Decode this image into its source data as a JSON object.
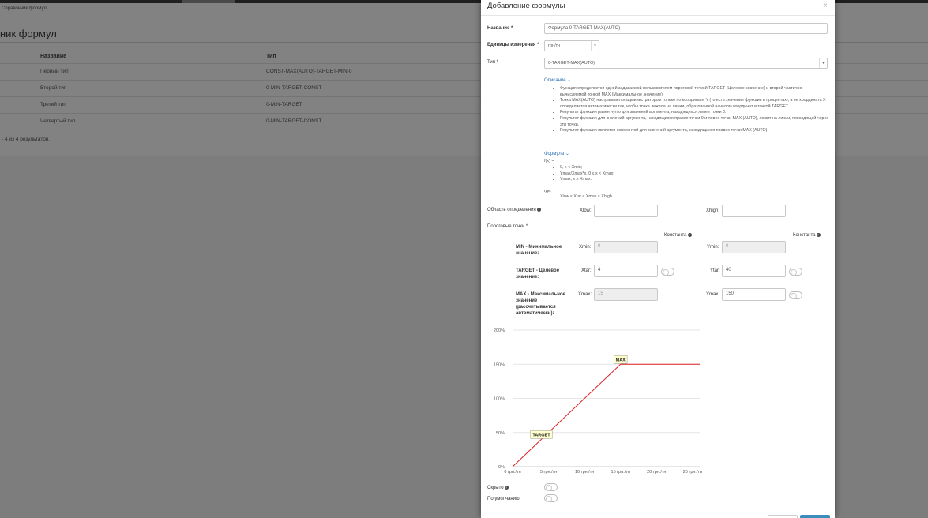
{
  "background": {
    "breadcrumb": "Справочник формул",
    "title": "ник формул",
    "columns": [
      "Название",
      "Тип"
    ],
    "rows": [
      {
        "name": "Первый тип",
        "type": "CONST-MAX(AUTO)-TARGET-MIN-0"
      },
      {
        "name": "Второй тип",
        "type": "0-MIN-TARGET-CONST"
      },
      {
        "name": "Третий тип",
        "type": "0-MIN-TARGET"
      },
      {
        "name": "Четвертый тип",
        "type": "0-MIN-TARGET-CONST"
      }
    ],
    "summary": "- 4 из 4 результатов."
  },
  "modal": {
    "title": "Добавление формулы",
    "close": "×",
    "name_label": "Название *",
    "name_value": "Формула 0-TARGET-MAX(AUTO)",
    "units_label": "Единицы измерения *",
    "units_value": "грн/тн",
    "type_label": "Тип *",
    "type_value": "0-TARGET-MAX(AUTO)",
    "description_link": "Описание",
    "description_items": [
      "Функция определяется одной задаваемой пользователем пороговой точкой TARGET (Целевое значение) и второй частично вычисляемой точкой MAX (Максимальное значение).",
      "Точка MAX(AUTO) настраивается администратором только по координате Y (то есть значение функции в процентах), а ее координата X определяется автоматически так, чтобы точка лежала на линии, образованной началом координат и точкой TARGET.",
      "Результат функции равен нулю для значений аргумента, находящихся левее точки 0.",
      "Результат функции для значений аргумента, находящихся правее точки 0 и левее точки MAX (AUTO), лежит на линии, проходящей через эти точки.",
      "Результат функции является константой для значений аргумента, находящихся правее точки MAX (AUTO)."
    ],
    "formula_link": "Формула",
    "formula_fx": "f(x) =",
    "formula_items": [
      "0, x < Xmin;",
      "Ymax/Xmax*x, 0 ≤ x < Xmax;",
      "Ymax, x ≥ Xmax."
    ],
    "formula_where": "где:",
    "formula_cond": "Xlow ≤ Xtar ≤ Xmax ≤ Xhigh",
    "domain_label": "Область определения",
    "xlow_label": "Xlow:",
    "xlow_value": "",
    "xhigh_label": "Xhigh:",
    "xhigh_value": "",
    "thresholds_label": "Пороговые точки *",
    "const_label": "Константа",
    "min_label": "MIN - Минимальное значение:",
    "xmin_label": "Xmin:",
    "xmin_value": "0",
    "ymin_label": "Ymin:",
    "ymin_value": "0",
    "target_label": "TARGET - Целевое значение:",
    "xtar_label": "Xtar:",
    "xtar_value": "4",
    "ytar_label": "Ytar:",
    "ytar_value": "40",
    "max_label": "MAX - Максимальное значение (рассчитывается автоматически):",
    "xmax_label": "Xmax:",
    "xmax_value": "15",
    "ymax_label": "Ymax:",
    "ymax_value": "150",
    "hidden_label": "Скрыто",
    "default_label": "По умолчанию"
  },
  "chart_data": {
    "type": "line",
    "y_ticks": [
      "0%",
      "50%",
      "100%",
      "150%",
      "200%"
    ],
    "x_ticks": [
      "0 грн./тн",
      "5 грн./тн",
      "10 грн./тн",
      "15 грн./тн",
      "20 грн./тн",
      "25 грн./тн"
    ],
    "xlim": [
      0,
      26
    ],
    "ylim": [
      0,
      200
    ],
    "points": [
      {
        "x": 0,
        "y": 0
      },
      {
        "x": 4,
        "y": 40
      },
      {
        "x": 15,
        "y": 150
      },
      {
        "x": 26,
        "y": 150
      }
    ],
    "annotations": [
      {
        "label": "TARGET",
        "x": 4,
        "y": 40
      },
      {
        "label": "MAX",
        "x": 15,
        "y": 150
      }
    ],
    "line_color": "#e02020",
    "grid": true
  }
}
